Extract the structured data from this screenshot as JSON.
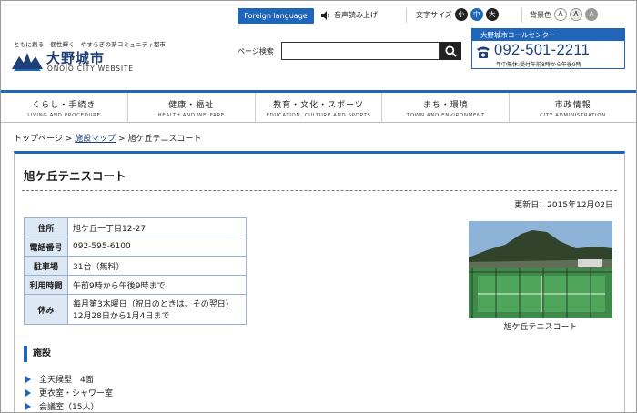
{
  "header": {
    "tagline": "ともに創る　個性輝く　やすらぎの新コミュニティ都市",
    "logo_name": "大野城市",
    "logo_sub": "ONOJO CITY WEBSITE",
    "foreign_language": "Foreign language",
    "voice_reading": "音声読み上げ",
    "font_size_label": "文字サイズ",
    "font_sizes": [
      "小",
      "中",
      "大"
    ],
    "bg_color_label": "背景色",
    "bg_colors": [
      "A",
      "A",
      "A"
    ],
    "search_label": "ページ検索",
    "search_placeholder": "",
    "call_center": {
      "title": "大野城市コールセンター",
      "number": "092-501-2211",
      "hours": "年中無休:受付午前8時から午後9時"
    }
  },
  "nav": [
    {
      "ja": "くらし・手続き",
      "en": "LIVING AND PROCEDURE"
    },
    {
      "ja": "健康・福祉",
      "en": "HEALTH AND WELFARE"
    },
    {
      "ja": "教育・文化・スポーツ",
      "en": "EDUCATION, CULTURE AND SPORTS"
    },
    {
      "ja": "まち・環境",
      "en": "TOWN AND ENVIRONMENT"
    },
    {
      "ja": "市政情報",
      "en": "CITY ADMINISTRATION"
    }
  ],
  "breadcrumb": {
    "home": "トップページ",
    "sep": ">",
    "facility_map": "施設マップ",
    "current": "旭ケ丘テニスコート"
  },
  "main": {
    "title": "旭ケ丘テニスコート",
    "updated": "更新日：2015年12月02日",
    "info_table": [
      {
        "label": "住所",
        "value": "旭ケ丘一丁目12-27"
      },
      {
        "label": "電話番号",
        "value": "092-595-6100"
      },
      {
        "label": "駐車場",
        "value": "31台（無料）"
      },
      {
        "label": "利用時間",
        "value": "午前9時から午後9時まで"
      },
      {
        "label": "休み",
        "value": "毎月第3木曜日（祝日のときは、その翌日）",
        "value2": "12月28日から1月4日まで"
      }
    ],
    "photo_caption": "旭ケ丘テニスコート",
    "section_title": "施設",
    "facilities": [
      "全天候型　4面",
      "更衣室・シャワー室",
      "会議室（15人）"
    ]
  },
  "colors": {
    "accent": "#1f66b8",
    "brand_dark": "#1d3f7a",
    "table_header_bg": "#dde8f5"
  }
}
